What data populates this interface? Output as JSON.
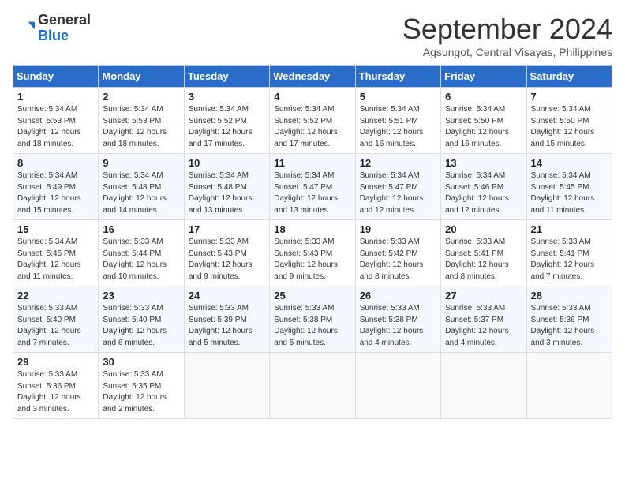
{
  "header": {
    "logo_general": "General",
    "logo_blue": "Blue",
    "month_title": "September 2024",
    "subtitle": "Agsungot, Central Visayas, Philippines"
  },
  "calendar": {
    "days_of_week": [
      "Sunday",
      "Monday",
      "Tuesday",
      "Wednesday",
      "Thursday",
      "Friday",
      "Saturday"
    ],
    "weeks": [
      [
        null,
        {
          "day": 2,
          "sunrise": "5:34 AM",
          "sunset": "5:53 PM",
          "daylight": "12 hours and 18 minutes."
        },
        {
          "day": 3,
          "sunrise": "5:34 AM",
          "sunset": "5:52 PM",
          "daylight": "12 hours and 17 minutes."
        },
        {
          "day": 4,
          "sunrise": "5:34 AM",
          "sunset": "5:52 PM",
          "daylight": "12 hours and 17 minutes."
        },
        {
          "day": 5,
          "sunrise": "5:34 AM",
          "sunset": "5:51 PM",
          "daylight": "12 hours and 16 minutes."
        },
        {
          "day": 6,
          "sunrise": "5:34 AM",
          "sunset": "5:50 PM",
          "daylight": "12 hours and 16 minutes."
        },
        {
          "day": 7,
          "sunrise": "5:34 AM",
          "sunset": "5:50 PM",
          "daylight": "12 hours and 15 minutes."
        }
      ],
      [
        {
          "day": 1,
          "sunrise": "5:34 AM",
          "sunset": "5:53 PM",
          "daylight": "12 hours and 18 minutes."
        },
        {
          "day": 9,
          "sunrise": "5:34 AM",
          "sunset": "5:48 PM",
          "daylight": "12 hours and 14 minutes."
        },
        {
          "day": 10,
          "sunrise": "5:34 AM",
          "sunset": "5:48 PM",
          "daylight": "12 hours and 13 minutes."
        },
        {
          "day": 11,
          "sunrise": "5:34 AM",
          "sunset": "5:47 PM",
          "daylight": "12 hours and 13 minutes."
        },
        {
          "day": 12,
          "sunrise": "5:34 AM",
          "sunset": "5:47 PM",
          "daylight": "12 hours and 12 minutes."
        },
        {
          "day": 13,
          "sunrise": "5:34 AM",
          "sunset": "5:46 PM",
          "daylight": "12 hours and 12 minutes."
        },
        {
          "day": 14,
          "sunrise": "5:34 AM",
          "sunset": "5:45 PM",
          "daylight": "12 hours and 11 minutes."
        }
      ],
      [
        {
          "day": 8,
          "sunrise": "5:34 AM",
          "sunset": "5:49 PM",
          "daylight": "12 hours and 15 minutes."
        },
        {
          "day": 16,
          "sunrise": "5:33 AM",
          "sunset": "5:44 PM",
          "daylight": "12 hours and 10 minutes."
        },
        {
          "day": 17,
          "sunrise": "5:33 AM",
          "sunset": "5:43 PM",
          "daylight": "12 hours and 9 minutes."
        },
        {
          "day": 18,
          "sunrise": "5:33 AM",
          "sunset": "5:43 PM",
          "daylight": "12 hours and 9 minutes."
        },
        {
          "day": 19,
          "sunrise": "5:33 AM",
          "sunset": "5:42 PM",
          "daylight": "12 hours and 8 minutes."
        },
        {
          "day": 20,
          "sunrise": "5:33 AM",
          "sunset": "5:41 PM",
          "daylight": "12 hours and 8 minutes."
        },
        {
          "day": 21,
          "sunrise": "5:33 AM",
          "sunset": "5:41 PM",
          "daylight": "12 hours and 7 minutes."
        }
      ],
      [
        {
          "day": 15,
          "sunrise": "5:34 AM",
          "sunset": "5:45 PM",
          "daylight": "12 hours and 11 minutes."
        },
        {
          "day": 23,
          "sunrise": "5:33 AM",
          "sunset": "5:40 PM",
          "daylight": "12 hours and 6 minutes."
        },
        {
          "day": 24,
          "sunrise": "5:33 AM",
          "sunset": "5:39 PM",
          "daylight": "12 hours and 5 minutes."
        },
        {
          "day": 25,
          "sunrise": "5:33 AM",
          "sunset": "5:38 PM",
          "daylight": "12 hours and 5 minutes."
        },
        {
          "day": 26,
          "sunrise": "5:33 AM",
          "sunset": "5:38 PM",
          "daylight": "12 hours and 4 minutes."
        },
        {
          "day": 27,
          "sunrise": "5:33 AM",
          "sunset": "5:37 PM",
          "daylight": "12 hours and 4 minutes."
        },
        {
          "day": 28,
          "sunrise": "5:33 AM",
          "sunset": "5:36 PM",
          "daylight": "12 hours and 3 minutes."
        }
      ],
      [
        {
          "day": 22,
          "sunrise": "5:33 AM",
          "sunset": "5:40 PM",
          "daylight": "12 hours and 7 minutes."
        },
        {
          "day": 30,
          "sunrise": "5:33 AM",
          "sunset": "5:35 PM",
          "daylight": "12 hours and 2 minutes."
        },
        null,
        null,
        null,
        null,
        null
      ],
      [
        {
          "day": 29,
          "sunrise": "5:33 AM",
          "sunset": "5:36 PM",
          "daylight": "12 hours and 3 minutes."
        },
        null,
        null,
        null,
        null,
        null,
        null
      ]
    ]
  }
}
